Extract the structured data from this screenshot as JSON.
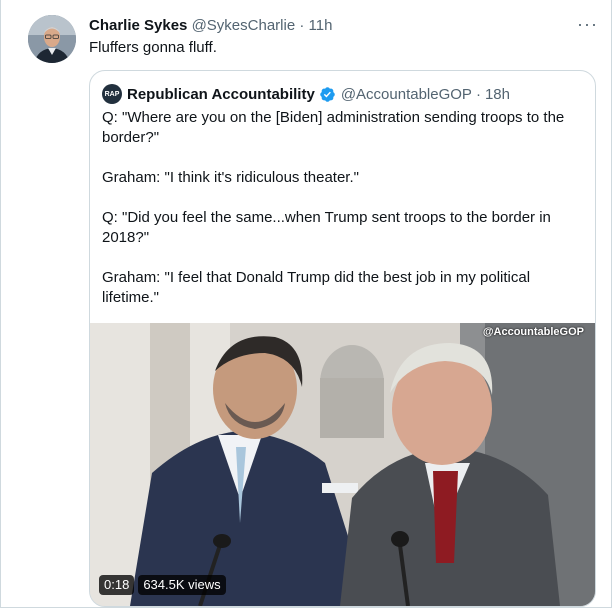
{
  "tweet": {
    "author_name": "Charlie Sykes",
    "handle": "@SykesCharlie",
    "separator": "·",
    "time": "11h",
    "more": "···",
    "text": "Fluffers gonna fluff."
  },
  "quote": {
    "logo_text": "RAP",
    "author_name": "Republican Accountability",
    "verified": true,
    "handle": "@AccountableGOP",
    "separator": "·",
    "time": "18h",
    "paragraphs": [
      "Q: \"Where are you on the [Biden] administration sending troops to the border?\"",
      "Graham: \"I think it's ridiculous theater.\"",
      "Q: \"Did you feel the same...when Trump sent troops to the border in 2018?\"",
      "Graham: \"I feel that Donald Trump did the best job in my political lifetime.\""
    ],
    "video": {
      "watermark": "@AccountableGOP",
      "duration": "0:18",
      "views": "634.5K views"
    }
  },
  "colors": {
    "verified": "#1d9bf0",
    "muted": "#536471",
    "border": "#cfd9de"
  }
}
